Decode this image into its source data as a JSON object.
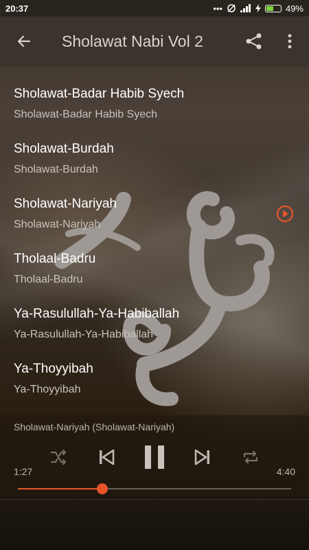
{
  "status": {
    "time": "20:37",
    "battery": "49%",
    "battery_level": 0.49
  },
  "toolbar": {
    "title": "Sholawat Nabi Vol 2",
    "back_icon": "arrow-left-icon",
    "share_icon": "share-icon",
    "more_icon": "more-vertical-icon"
  },
  "songs": [
    {
      "title": "Sholawat-Badar Habib Syech",
      "subtitle": "Sholawat-Badar Habib Syech"
    },
    {
      "title": "Sholawat-Burdah",
      "subtitle": "Sholawat-Burdah"
    },
    {
      "title": "Sholawat-Nariyah",
      "subtitle": "Sholawat-Nariyah"
    },
    {
      "title": "Tholaal-Badru",
      "subtitle": "Tholaal-Badru"
    },
    {
      "title": "Ya-Rasulullah-Ya-Habiballah",
      "subtitle": "Ya-Rasulullah-Ya-Habiballah"
    },
    {
      "title": "Ya-Thoyyibah",
      "subtitle": "Ya-Thoyyibah"
    }
  ],
  "player": {
    "now_playing": "Sholawat-Nariyah (Sholawat-Nariyah)",
    "elapsed": "1:27",
    "duration": "4:40",
    "progress": 0.31,
    "accent": "#e8552a"
  }
}
